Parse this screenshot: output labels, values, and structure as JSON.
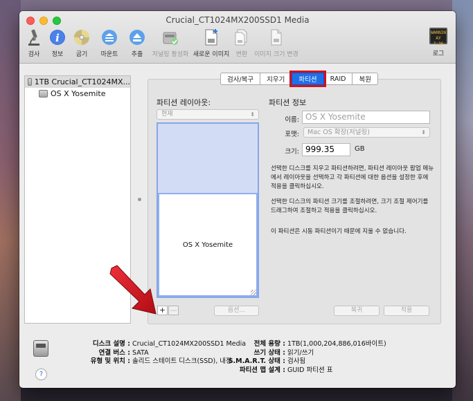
{
  "window": {
    "title": "Crucial_CT1024MX200SSD1 Media"
  },
  "toolbar": {
    "items": [
      {
        "label": "검사",
        "icon": "microscope-icon",
        "enabled": true
      },
      {
        "label": "정보",
        "icon": "info-icon",
        "enabled": true
      },
      {
        "label": "굽기",
        "icon": "burn-disc-icon",
        "enabled": true
      },
      {
        "label": "마운트",
        "icon": "mount-icon",
        "enabled": true
      },
      {
        "label": "추출",
        "icon": "eject-icon",
        "enabled": true
      },
      {
        "label": "저널링 활성화",
        "icon": "journaling-icon",
        "enabled": false
      },
      {
        "label": "새로운 이미지",
        "icon": "new-image-icon",
        "enabled": true
      },
      {
        "label": "변환",
        "icon": "convert-icon",
        "enabled": false
      },
      {
        "label": "이미지 크기 변경",
        "icon": "resize-image-icon",
        "enabled": false
      }
    ],
    "log_label": "로그",
    "log_screen_text": "WARNIN AY 7:36"
  },
  "sidebar": {
    "disk": "1TB Crucial_CT1024MX...",
    "volume": "OS X Yosemite"
  },
  "tabs": [
    {
      "label": "검사/복구",
      "active": false
    },
    {
      "label": "지우기",
      "active": false
    },
    {
      "label": "파티션",
      "active": true
    },
    {
      "label": "RAID",
      "active": false
    },
    {
      "label": "복원",
      "active": false
    }
  ],
  "partition": {
    "layout_label": "파티션 레이아웃:",
    "layout_popup": "현재",
    "partition_name": "OS X Yosemite",
    "add_label": "+",
    "remove_label": "—",
    "options_label": "옵션...",
    "info_title": "파티션 정보",
    "name_label": "이름:",
    "name_placeholder": "OS X Yosemite",
    "format_label": "포맷:",
    "format_value": "Mac OS 확장(저널링)",
    "size_label": "크기:",
    "size_value": "999.35",
    "size_unit": "GB",
    "help_text_1": "선택한 디스크를 지우고 파티션하려면, 파티션 레이아웃 팝업 메뉴에서 레이아웃을 선택하고 각 파티션에 대한 옵션을 설정한 후에 적용을 클릭하십시오.",
    "help_text_2": "선택한 디스크의 파티션 크기를 조절하려면, 크기 조절 제어기를 드래그하여 조절하고 적용을 클릭하십시오.",
    "help_text_3": "이 파티션은 시동 파티션이기 때문에 지울 수 없습니다.",
    "revert_label": "복귀",
    "apply_label": "적용"
  },
  "disk_info": {
    "desc_key": "디스크 설명 :",
    "desc_val": "Crucial_CT1024MX200SSD1 Media",
    "bus_key": "연결 버스 :",
    "bus_val": "SATA",
    "type_key": "유형 및 위치 :",
    "type_val": "솔리드 스테이트 디스크(SSD), 내장",
    "capacity_key": "전체 용량 :",
    "capacity_val": "1TB(1,000,204,886,016바이트)",
    "write_key": "쓰기 상태 :",
    "write_val": "읽기/쓰기",
    "smart_key": "S.M.A.R.T. 상태 :",
    "smart_val": "검사됨",
    "map_key": "파티션 맵 설계 :",
    "map_val": "GUID 파티션 표"
  },
  "help_button": "?",
  "colors": {
    "active_tab": "#1f6fe8",
    "highlight_box": "#d0121a",
    "arrow": "#d0121a"
  }
}
